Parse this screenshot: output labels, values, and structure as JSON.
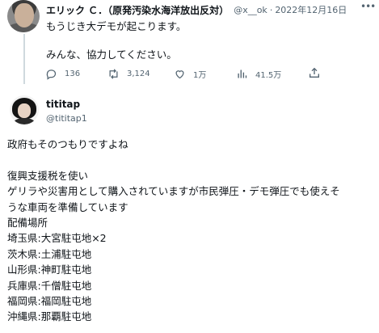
{
  "parent": {
    "name": "エリック Ｃ．（原発汚染水海洋放出反対）",
    "handle": "@x__ok",
    "separator": "·",
    "date": "2022年12月16日",
    "more_icon": "more-horizontal-icon",
    "lines": [
      "もうじき大デモが起こります。",
      "みんな、協力してください。"
    ],
    "actions": {
      "reply_count": "136",
      "retweet_count": "3,124",
      "like_count": "1万",
      "views_count": "41.5万"
    }
  },
  "reply": {
    "name": "tititap",
    "handle": "@tititap1",
    "paragraphs": [
      [
        "政府もそのつもりですよね"
      ],
      [
        "復興支援税を使い",
        "ゲリラや災害用として購入されていますが市民弾圧・デモ弾圧でも使えそ",
        "うな車両を準備しています",
        "配備場所",
        "埼玉県:大宮駐屯地×2",
        "茨木県:土浦駐屯地",
        "山形県:神町駐屯地",
        "兵庫県:千僧駐屯地",
        "福岡県:福岡駐屯地",
        "沖縄県:那覇駐屯地"
      ]
    ]
  },
  "colors": {
    "text": "#0f1419",
    "secondary": "#536471",
    "thread_line": "#cfd9de"
  }
}
